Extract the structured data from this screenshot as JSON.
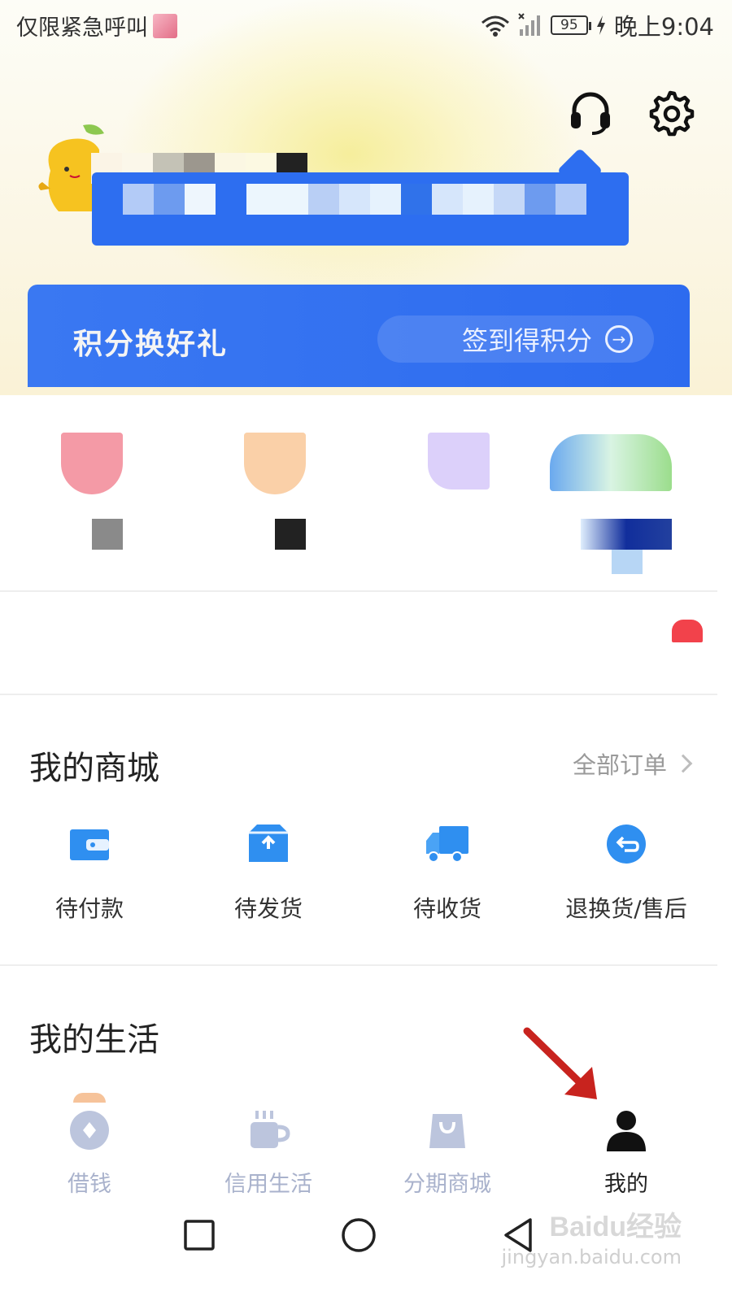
{
  "status_bar": {
    "left_text": "仅限紧急呼叫",
    "battery": "95",
    "time": "晚上9:04"
  },
  "header": {
    "icons": [
      "headset-icon",
      "gear-icon"
    ]
  },
  "points_banner": {
    "title": "积分换好礼",
    "checkin_label": "签到得积分"
  },
  "mall": {
    "title": "我的商城",
    "all_orders": "全部订单",
    "items": [
      {
        "label": "待付款",
        "icon": "wallet-icon"
      },
      {
        "label": "待发货",
        "icon": "box-icon"
      },
      {
        "label": "待收货",
        "icon": "truck-icon"
      },
      {
        "label": "退换货/售后",
        "icon": "return-icon"
      }
    ]
  },
  "life": {
    "title": "我的生活"
  },
  "tabbar": {
    "items": [
      {
        "label": "借钱",
        "icon": "coin-icon",
        "active": false
      },
      {
        "label": "信用生活",
        "icon": "cup-icon",
        "active": false
      },
      {
        "label": "分期商城",
        "icon": "shopping-bag-icon",
        "active": false
      },
      {
        "label": "我的",
        "icon": "person-icon",
        "active": true
      }
    ]
  },
  "watermark": {
    "brand": "Baidu经验",
    "url": "jingyan.baidu.com"
  },
  "colors": {
    "accent": "#2d6ef0",
    "icon_blue": "#2f8ff0",
    "tab_inactive": "#a9b2cc",
    "red_annotation": "#c8231e"
  }
}
